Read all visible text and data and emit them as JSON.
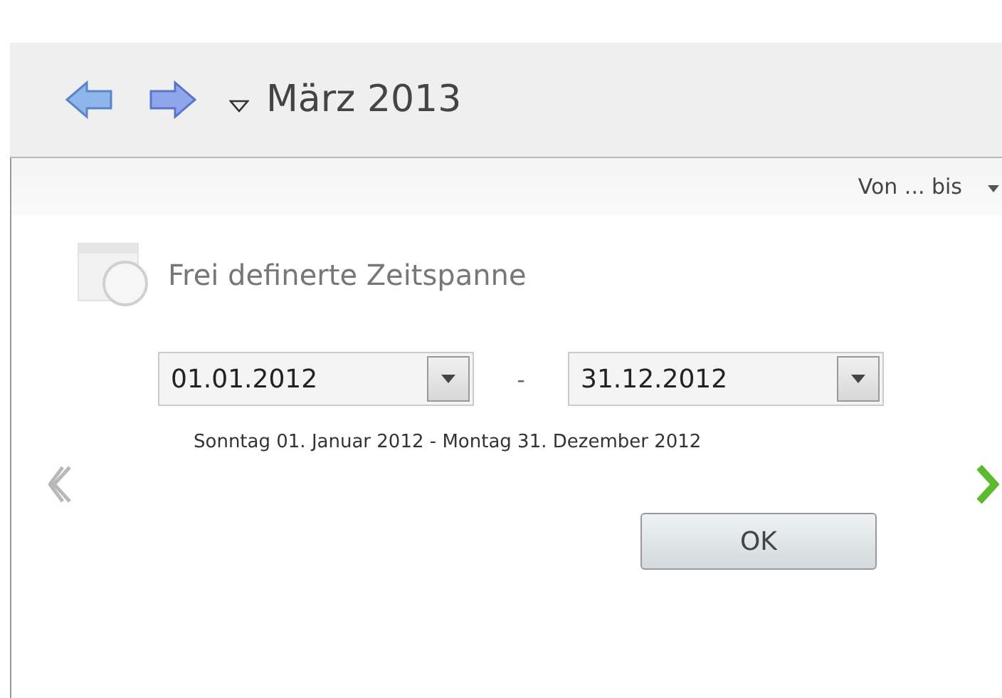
{
  "header": {
    "title": "März 2013"
  },
  "view_selector": {
    "label": "Von ... bis"
  },
  "option": {
    "label": "Frei definerte Zeitspanne"
  },
  "range": {
    "from": "01.01.2012",
    "separator": "-",
    "to": "31.12.2012",
    "summary": "Sonntag 01. Januar 2012 - Montag 31. Dezember 2012"
  },
  "pager": {
    "previous_disabled": true,
    "next_disabled": false
  },
  "buttons": [
    "OK"
  ]
}
